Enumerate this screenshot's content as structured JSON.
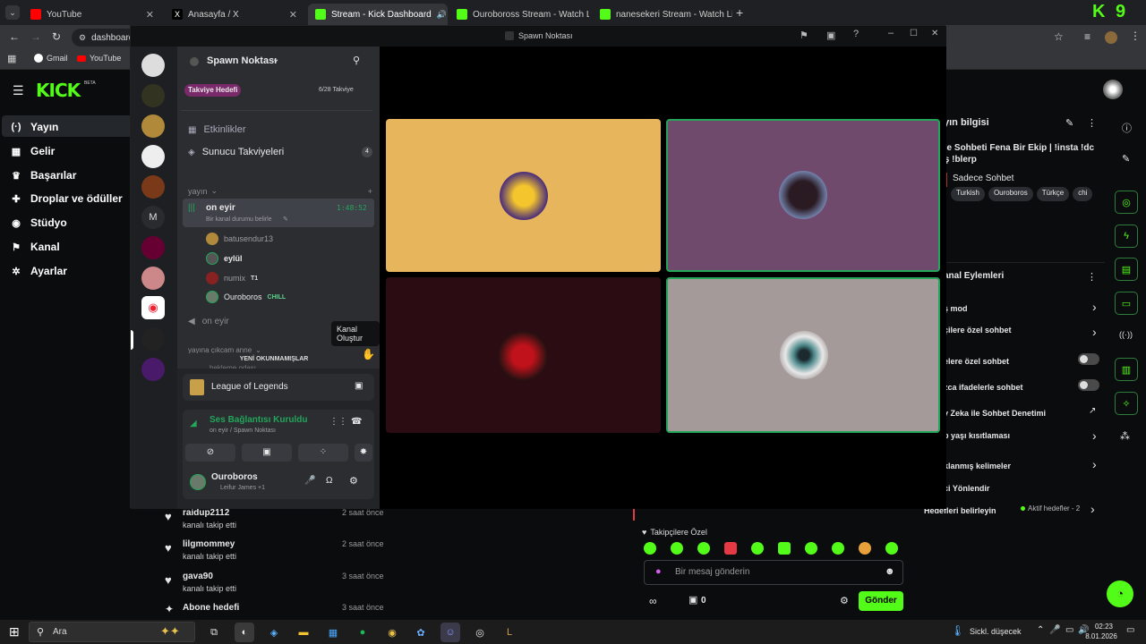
{
  "browser": {
    "tabs": [
      {
        "label": "YouTube",
        "active": false
      },
      {
        "label": "Anasayfa / X",
        "active": false
      },
      {
        "label": "Stream - Kick Dashboard",
        "active": true
      },
      {
        "label": "Ouroboross Stream - Watch Live",
        "active": false
      },
      {
        "label": "nanesekeri Stream - Watch Live",
        "active": false
      }
    ],
    "address": "dashboard",
    "bookmarks": [
      "Gmail",
      "YouTube"
    ],
    "profile_badge": "9"
  },
  "kick": {
    "logo": "KICK",
    "logo_badge": "BETA",
    "nav": [
      {
        "label": "Yayın",
        "icon": "broadcast-icon",
        "glyph": "(·)"
      },
      {
        "label": "Gelir",
        "icon": "money-icon",
        "glyph": "▦"
      },
      {
        "label": "Başarılar",
        "icon": "trophy-icon",
        "glyph": "♛"
      },
      {
        "label": "Droplar ve ödüller",
        "icon": "gift-icon",
        "glyph": "✚"
      },
      {
        "label": "Stüdyo",
        "icon": "studio-icon",
        "glyph": "◉"
      },
      {
        "label": "Kanal",
        "icon": "channel-icon",
        "glyph": "⚑"
      },
      {
        "label": "Ayarlar",
        "icon": "settings-icon",
        "glyph": "✲"
      }
    ],
    "stream_info": {
      "title": "yın bilgisi",
      "stream_title": "ce Sohbeti Fena Bir Ekip | !insta !dc ış !blerp",
      "category": "Sadece Sohbet",
      "tags": [
        "Turkish",
        "Ouroboros",
        "Türkçe",
        "chi"
      ]
    },
    "channel_actions": {
      "title": "anal Eylemleri",
      "items": [
        {
          "label": "ş mod",
          "control": "chevron"
        },
        {
          "label": "çilere özel sohbet",
          "control": "chevron"
        },
        {
          "label": "elere özel sohbet",
          "control": "toggle"
        },
        {
          "label": "zca ifadelerle sohbet",
          "control": "toggle"
        },
        {
          "label": "y Zeka ile Sohbet Denetimi",
          "control": "external"
        },
        {
          "label": "p yaşı kısıtlaması",
          "control": "chevron"
        },
        {
          "label": "klanmış kelimeler",
          "control": "chevron"
        },
        {
          "label": "ci Yönlendir",
          "control": "none"
        }
      ],
      "goals_label": "Hedefleri belirleyin",
      "goals_status": "Aktif hedefler - 2"
    },
    "activity": [
      {
        "user": "raidup2112",
        "action": "kanalı takip etti",
        "time": "2 saat önce"
      },
      {
        "user": "lilgmommey",
        "action": "kanalı takip etti",
        "time": "2 saat önce"
      },
      {
        "user": "gava90",
        "action": "kanalı takip etti",
        "time": "3 saat önce"
      },
      {
        "user": "Abone hedefi",
        "action": "",
        "time": "3 saat önce"
      }
    ],
    "chat": {
      "followers_only": "Takipçilere Özel",
      "placeholder": "Bir mesaj gönderin",
      "send": "Gönder",
      "points": "0"
    }
  },
  "discord": {
    "window_title": "Spawn Noktası",
    "server_name": "Spawn Noktası",
    "boost_goal": "Takviye Hedefi",
    "boost_count": "6/28 Takviye",
    "events": "Etkinlikler",
    "server_boosts": "Sunucu Takviyeleri",
    "server_boosts_count": "4",
    "category": "yayın",
    "active_channel": "on eyir",
    "active_channel_timer": "1:48:52",
    "channel_status": "Bir kanal durumu belirle",
    "voice_users": [
      {
        "name": "batusendur13",
        "tag": ""
      },
      {
        "name": "eylül",
        "tag": ""
      },
      {
        "name": "numix",
        "tag": "T1"
      },
      {
        "name": "Ouroboros",
        "tag": "CHILL"
      }
    ],
    "second_channel": "on eyir",
    "third_category": "yayına çıkcam anne",
    "hidden_channel": "bekleme odası",
    "tooltip": "Kanal Oluştur",
    "unread_banner": "YENİ OKUNMAMIŞLAR",
    "activity_game": "League of Legends",
    "voice_connected": "Ses Bağlantısı Kuruldu",
    "voice_location": "on eyir / Spawn Noktası",
    "user_name": "Ouroboros",
    "user_status": "Leifur James +1"
  },
  "taskbar": {
    "search": "Ara",
    "weather": "Sickl. düşecek",
    "time": "02:23",
    "date": "8.01.2026"
  },
  "colors": {
    "kick_green": "#53fc18",
    "discord_green": "#23a55a"
  }
}
